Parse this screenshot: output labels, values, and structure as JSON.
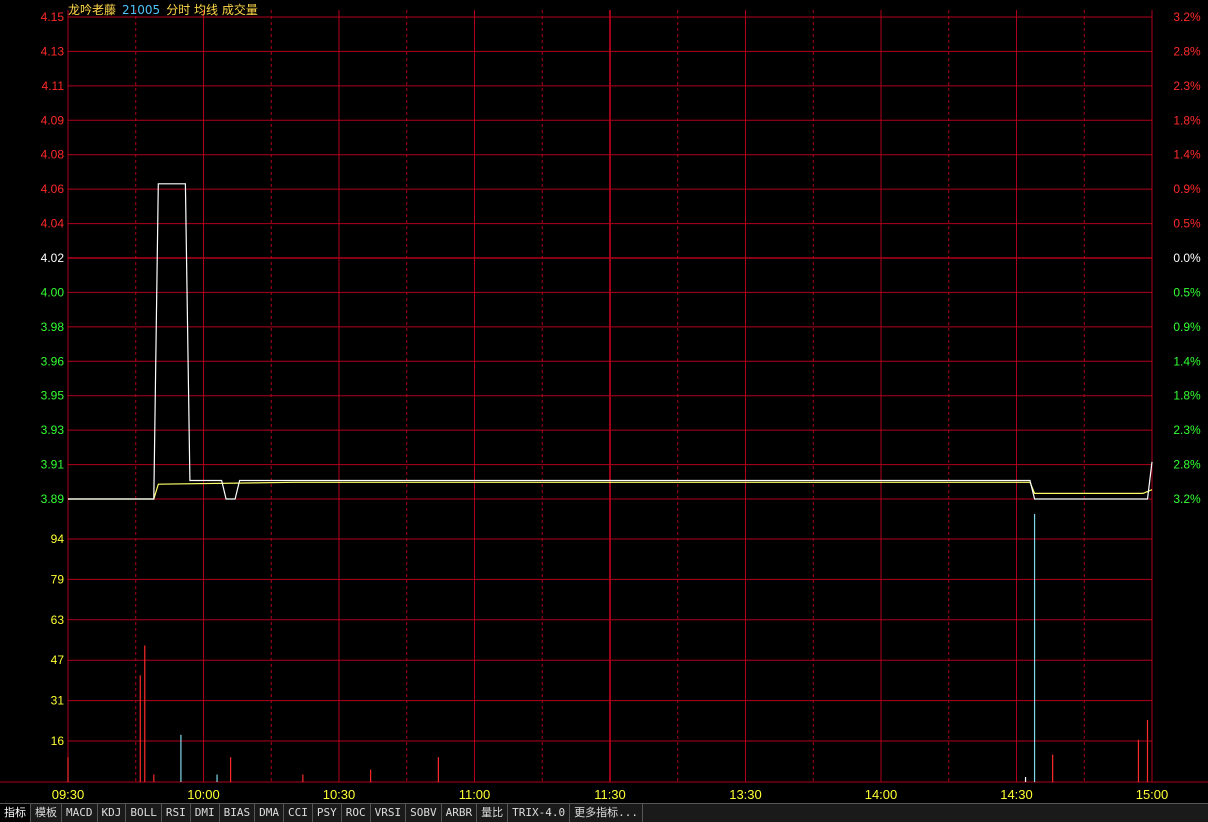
{
  "header": {
    "stock_name": "龙吟老藤",
    "stock_code": "21005",
    "chart_mode": "分时",
    "avg_line_label": "均线",
    "volume_label": "成交量"
  },
  "tabs": [
    "指标",
    "模板",
    "MACD",
    "KDJ",
    "BOLL",
    "RSI",
    "DMI",
    "BIAS",
    "DMA",
    "CCI",
    "PSY",
    "ROC",
    "VRSI",
    "SOBV",
    "ARBR",
    "量比",
    "TRIX-4.0",
    "更多指标..."
  ],
  "colors": {
    "grid": "#b0001a",
    "up": "#ff2a2a",
    "down": "#33ff33",
    "flat": "#ffffff",
    "volume_axis": "#ffff33",
    "price_line": "#ffffff",
    "avg_line": "#ffff66"
  },
  "chart_data": [
    {
      "type": "line",
      "name": "intraday-price",
      "prev_close": 4.02,
      "ylim": [
        3.89,
        4.15
      ],
      "y_ticks": [
        "4.15",
        "4.13",
        "4.11",
        "4.09",
        "4.08",
        "4.06",
        "4.04",
        "4.02",
        "4.00",
        "3.98",
        "3.96",
        "3.95",
        "3.93",
        "3.91",
        "3.89"
      ],
      "pct_ticks": [
        "3.2%",
        "2.8%",
        "2.3%",
        "1.8%",
        "1.4%",
        "0.9%",
        "0.5%",
        "0.0%",
        "0.5%",
        "0.9%",
        "1.4%",
        "1.8%",
        "2.3%",
        "2.8%",
        "3.2%"
      ],
      "x_ticks": [
        "09:30",
        "10:00",
        "10:30",
        "11:00",
        "11:30",
        "13:30",
        "14:00",
        "14:30",
        "15:00"
      ],
      "price": [
        {
          "t": 0,
          "v": 3.89
        },
        {
          "t": 19,
          "v": 3.89
        },
        {
          "t": 20,
          "v": 4.06
        },
        {
          "t": 26,
          "v": 4.06
        },
        {
          "t": 27,
          "v": 3.9
        },
        {
          "t": 34,
          "v": 3.9
        },
        {
          "t": 35,
          "v": 3.89
        },
        {
          "t": 37,
          "v": 3.89
        },
        {
          "t": 38,
          "v": 3.9
        },
        {
          "t": 213,
          "v": 3.9
        },
        {
          "t": 214,
          "v": 3.89
        },
        {
          "t": 239,
          "v": 3.89
        },
        {
          "t": 240,
          "v": 3.91
        }
      ],
      "average": [
        {
          "t": 0,
          "v": 3.89
        },
        {
          "t": 19,
          "v": 3.89
        },
        {
          "t": 20,
          "v": 3.898
        },
        {
          "t": 50,
          "v": 3.899
        },
        {
          "t": 213,
          "v": 3.899
        },
        {
          "t": 214,
          "v": 3.893
        },
        {
          "t": 238,
          "v": 3.893
        },
        {
          "t": 240,
          "v": 3.895
        }
      ]
    },
    {
      "type": "bar",
      "name": "volume",
      "ylim": [
        0,
        110
      ],
      "y_ticks": [
        "94",
        "79",
        "63",
        "47",
        "31",
        "16"
      ],
      "bars": [
        {
          "t": 0,
          "v": 10,
          "dir": "up"
        },
        {
          "t": 16,
          "v": 43,
          "dir": "up"
        },
        {
          "t": 17,
          "v": 55,
          "dir": "up"
        },
        {
          "t": 19,
          "v": 3,
          "dir": "up"
        },
        {
          "t": 25,
          "v": 19,
          "dir": "down"
        },
        {
          "t": 33,
          "v": 3,
          "dir": "down"
        },
        {
          "t": 36,
          "v": 10,
          "dir": "up"
        },
        {
          "t": 52,
          "v": 3,
          "dir": "up"
        },
        {
          "t": 67,
          "v": 5,
          "dir": "up"
        },
        {
          "t": 82,
          "v": 10,
          "dir": "up"
        },
        {
          "t": 214,
          "v": 108,
          "dir": "down"
        },
        {
          "t": 212,
          "v": 2,
          "dir": "flat"
        },
        {
          "t": 218,
          "v": 11,
          "dir": "up"
        },
        {
          "t": 237,
          "v": 17,
          "dir": "up"
        },
        {
          "t": 239,
          "v": 25,
          "dir": "up"
        }
      ]
    }
  ]
}
